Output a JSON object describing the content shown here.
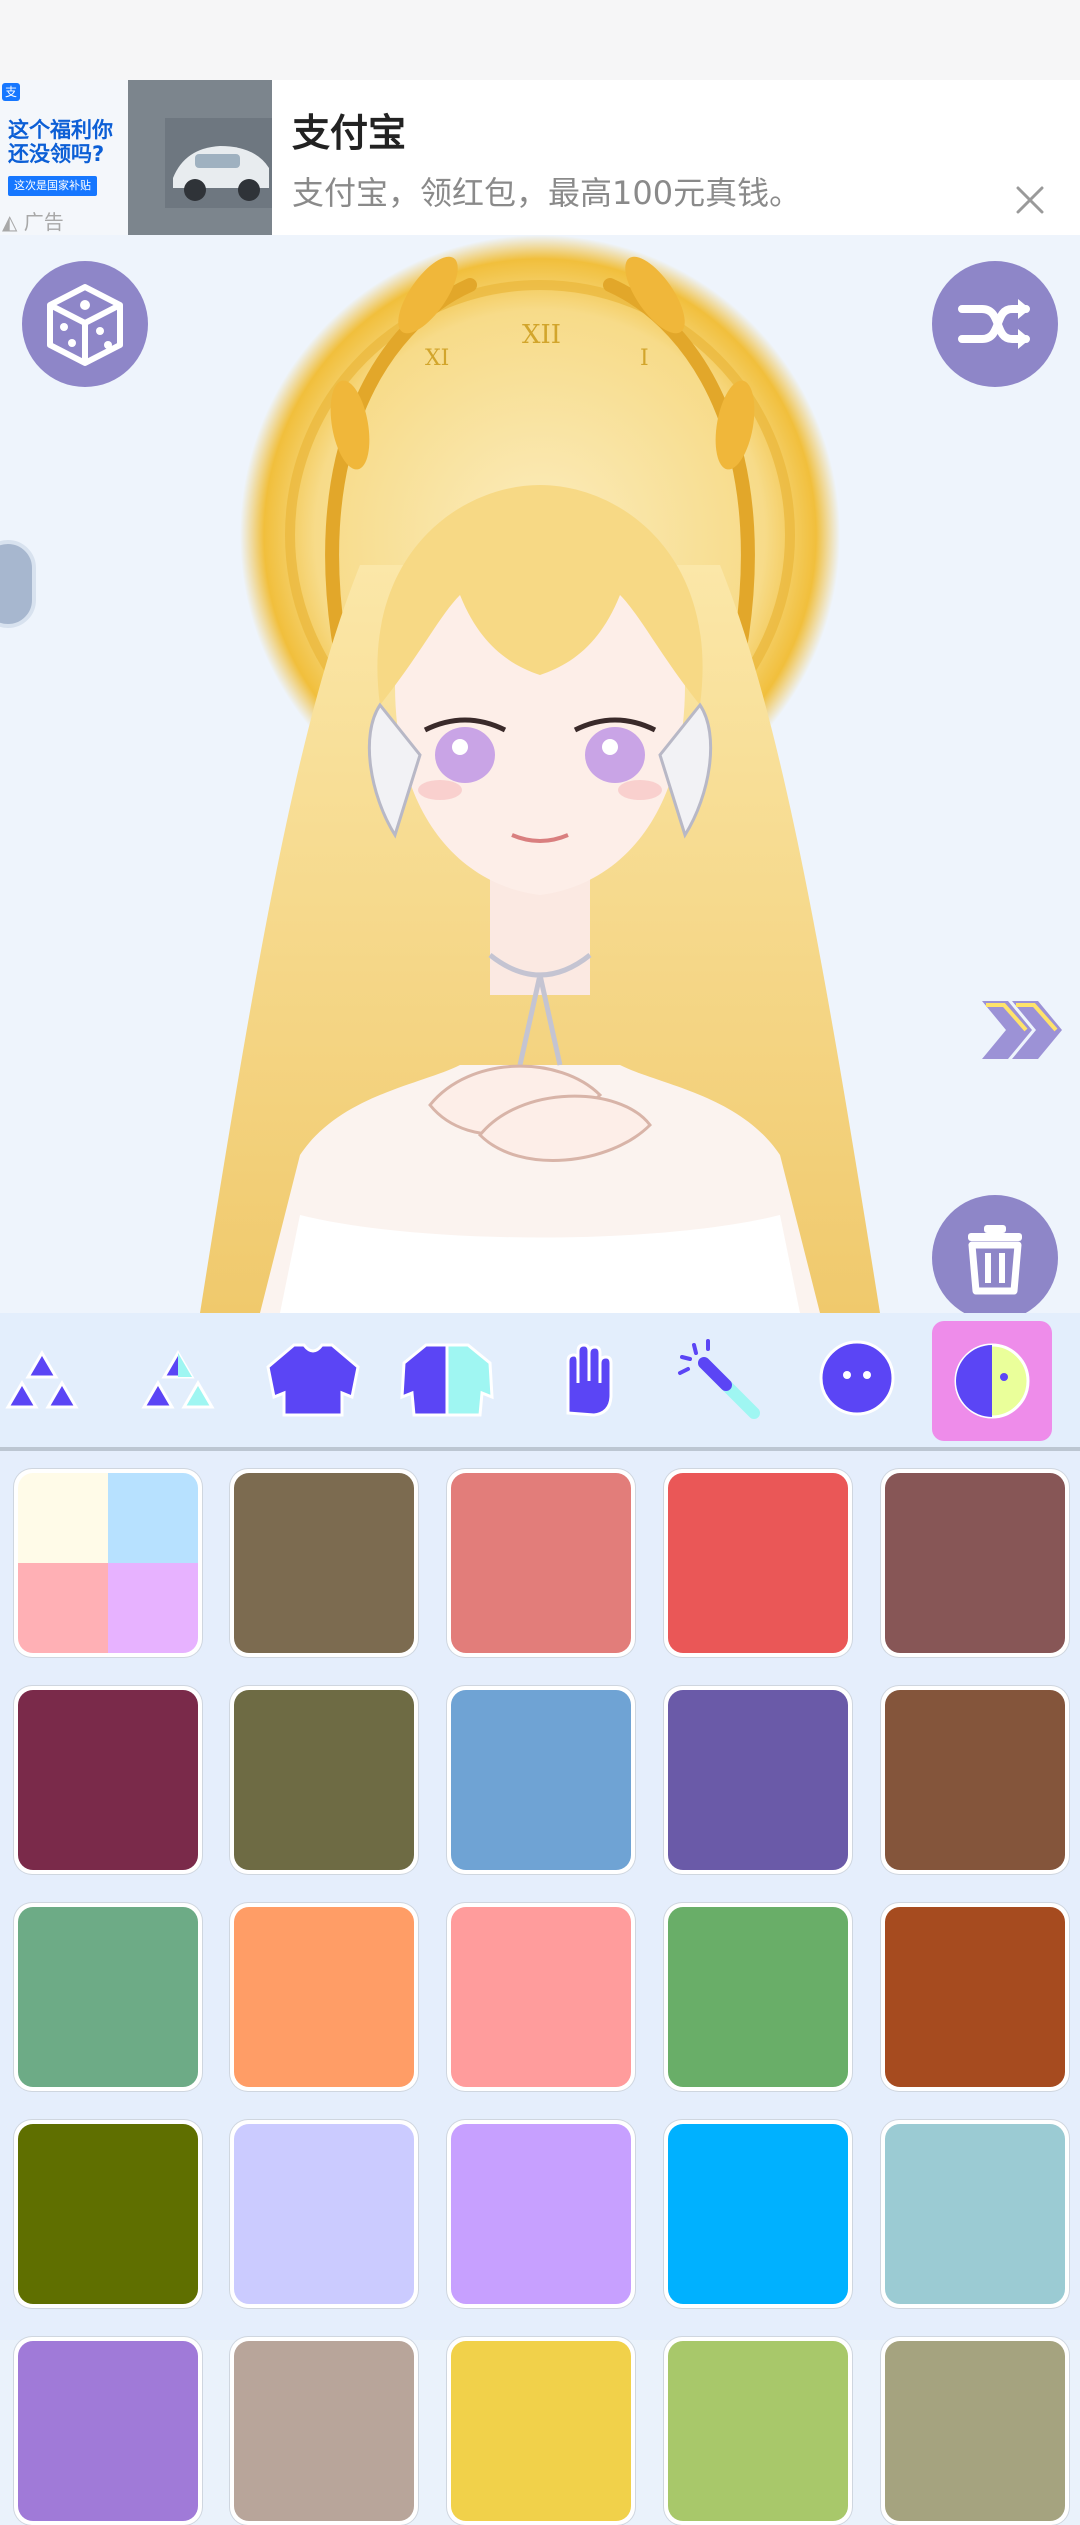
{
  "ad": {
    "title": "支付宝",
    "description": "支付宝，领红包，最高100元真钱。",
    "thumbnail_text": "这个福利你还没领吗?",
    "thumbnail_button": "这次是国家补贴",
    "label": "广告",
    "close_icon": "close-icon"
  },
  "buttons": {
    "random_icon": "dice-icon",
    "shuffle_icon": "shuffle-icon",
    "next_icon": "double-chevron-right-icon",
    "delete_icon": "trash-icon"
  },
  "tabs": [
    {
      "name": "accessories-1",
      "icon": "triangles-icon"
    },
    {
      "name": "accessories-2",
      "icon": "triangles-half-icon"
    },
    {
      "name": "top",
      "icon": "shirt-icon"
    },
    {
      "name": "outer",
      "icon": "jacket-icon"
    },
    {
      "name": "hands",
      "icon": "hand-icon"
    },
    {
      "name": "effects",
      "icon": "magic-wand-icon"
    },
    {
      "name": "face",
      "icon": "face-icon"
    },
    {
      "name": "colors",
      "icon": "color-split-icon",
      "active": true
    }
  ],
  "colors": [
    {
      "type": "multi",
      "colors": [
        "#fffbe8",
        "#b7e1ff",
        "#ffb0b5",
        "#e7b2ff"
      ]
    },
    {
      "color": "#7c6b50"
    },
    {
      "color": "#e27d7a"
    },
    {
      "color": "#ea5757"
    },
    {
      "color": "#875656"
    },
    {
      "color": "#7a2a4a"
    },
    {
      "color": "#6e6b44"
    },
    {
      "color": "#6fa3d4"
    },
    {
      "color": "#6a5aa8"
    },
    {
      "color": "#84553b"
    },
    {
      "color": "#6dab86"
    },
    {
      "color": "#ff9d66"
    },
    {
      "color": "#ff9c9c"
    },
    {
      "color": "#69ae68"
    },
    {
      "color": "#a64b1f"
    },
    {
      "color": "#5f6f00"
    },
    {
      "color": "#cbcbff"
    },
    {
      "color": "#c7a0ff"
    },
    {
      "color": "#00b1ff"
    },
    {
      "color": "#9bcbd3"
    },
    {
      "color": "#a07ad8"
    },
    {
      "color": "#b8a59a"
    },
    {
      "color": "#f1d14a"
    },
    {
      "color": "#a8c86a"
    },
    {
      "color": "#a5a37f"
    }
  ]
}
